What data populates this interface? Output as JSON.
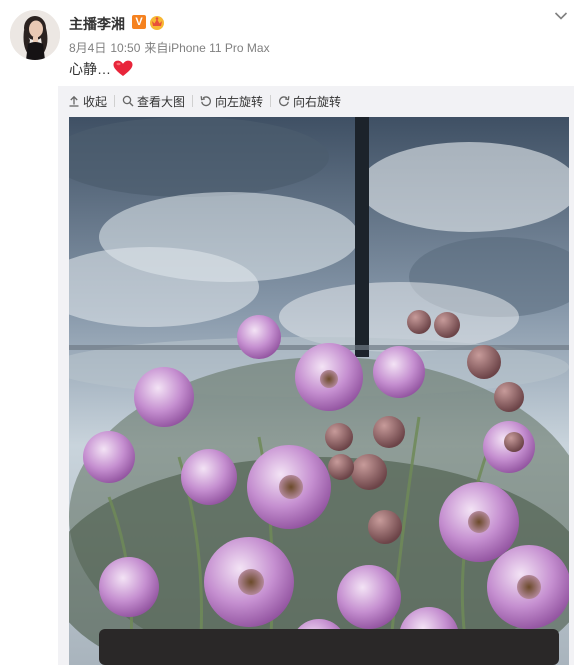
{
  "post": {
    "author_name": "主播李湘",
    "verified_badge": "V",
    "date": "8月4日",
    "time": "10:50",
    "source_prefix": "来自",
    "source_device": "iPhone 11 Pro Max",
    "text": "心静…"
  },
  "toolbar": {
    "collapse_label": "收起",
    "view_large_label": "查看大图",
    "rotate_left_label": "向左旋转",
    "rotate_right_label": "向右旋转"
  },
  "icons": {
    "expand": "chevron-down-icon",
    "heart": "heart-icon",
    "collapse": "arrow-up-icon",
    "view_large": "magnifier-icon",
    "rotate_left": "rotate-left-icon",
    "rotate_right": "rotate-right-icon",
    "crown_badge": "crown-badge-icon"
  },
  "colors": {
    "heart": "#e8253a",
    "verified_badge": "#f58220",
    "meta_text": "#808080",
    "panel_bg": "#f2f2f5"
  }
}
